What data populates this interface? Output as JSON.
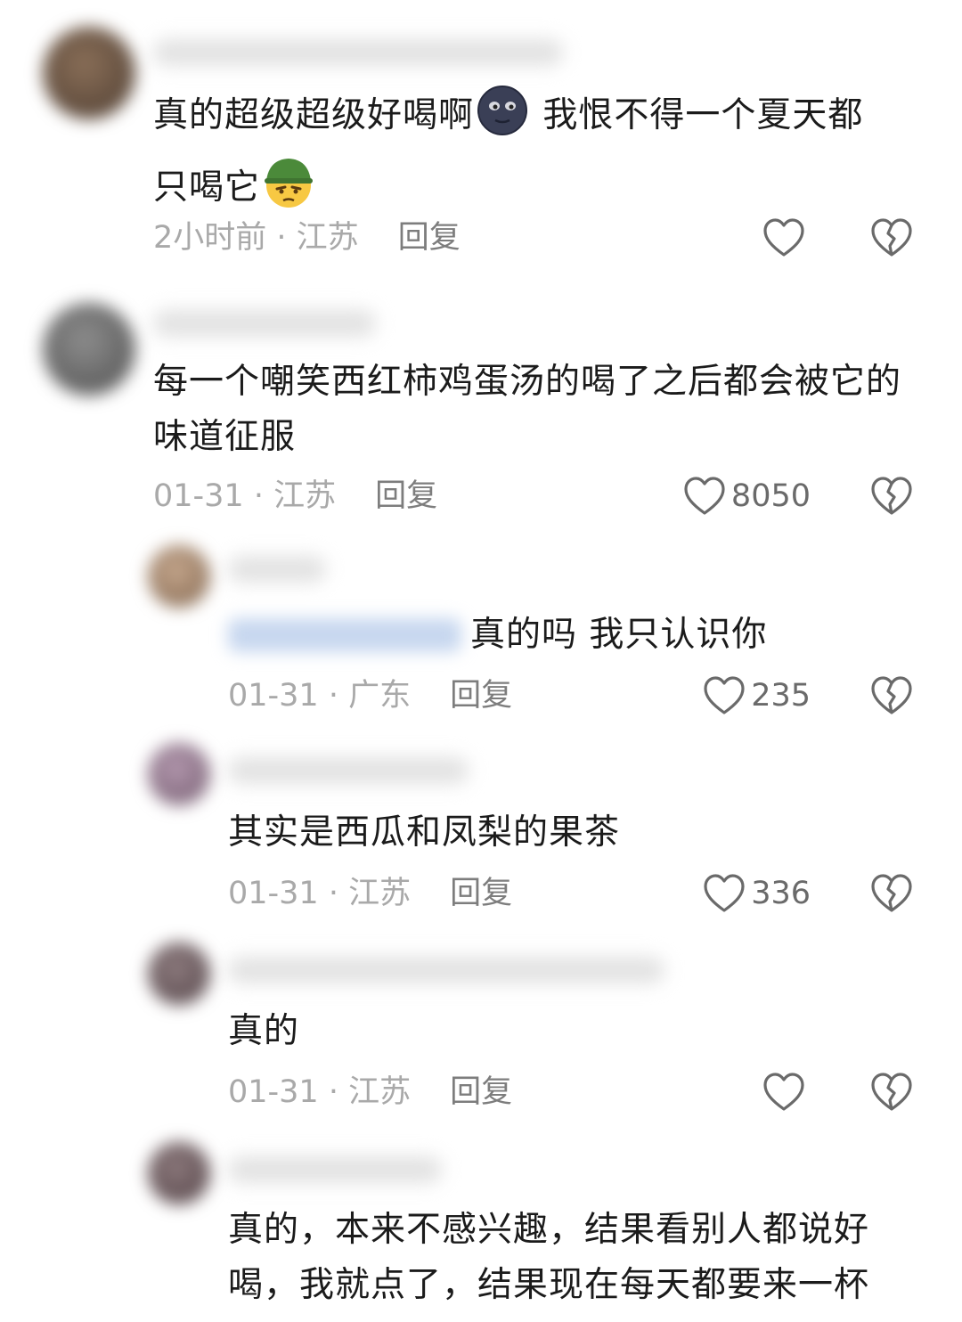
{
  "comments": [
    {
      "text_a": "真的超级超级好喝啊",
      "text_b": " 我恨不得一个夏天都",
      "text_c": "只喝它",
      "emoji_1": "new-moon-face-emoji",
      "emoji_2": "soldier-helmet-face-emoji",
      "time": "2小时前",
      "location": "江苏",
      "reply": "回复",
      "likes": ""
    },
    {
      "text": "每一个嘲笑西红柿鸡蛋汤的喝了之后都会被它的味道征服",
      "time": "01-31",
      "location": "江苏",
      "reply": "回复",
      "likes": "8050"
    },
    {
      "text": "真的吗 我只认识你",
      "time": "01-31",
      "location": "广东",
      "reply": "回复",
      "likes": "235"
    },
    {
      "text": "其实是西瓜和凤梨的果茶",
      "time": "01-31",
      "location": "江苏",
      "reply": "回复",
      "likes": "336"
    },
    {
      "text": "真的",
      "time": "01-31",
      "location": "江苏",
      "reply": "回复",
      "likes": ""
    },
    {
      "text": "真的，本来不感兴趣，结果看别人都说好喝，我就点了，结果现在每天都要来一杯"
    }
  ],
  "separator": " · ",
  "icons": {
    "like": "heart-icon",
    "dislike": "broken-heart-icon"
  }
}
